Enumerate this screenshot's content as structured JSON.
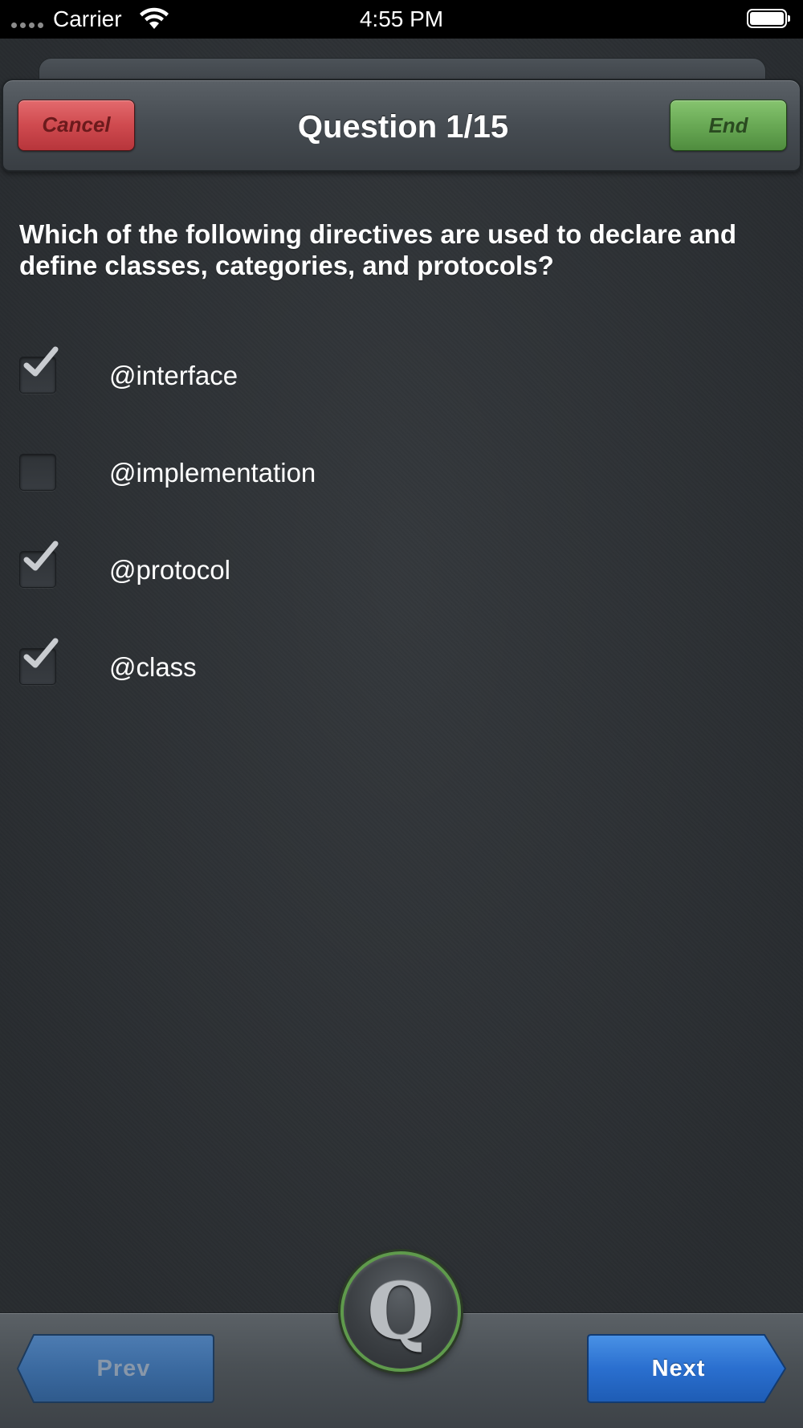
{
  "status_bar": {
    "carrier": "Carrier",
    "time": "4:55 PM",
    "icons": [
      "signal-dots-icon",
      "wifi-icon",
      "battery-icon"
    ]
  },
  "header": {
    "cancel_label": "Cancel",
    "title": "Question 1/15",
    "end_label": "End"
  },
  "question": {
    "text": "Which of the following directives are used to declare and define classes, categories, and protocols?"
  },
  "answers": [
    {
      "label": "@interface",
      "checked": true
    },
    {
      "label": "@implementation",
      "checked": false
    },
    {
      "label": "@protocol",
      "checked": true
    },
    {
      "label": "@class",
      "checked": true
    }
  ],
  "bottom_bar": {
    "prev_label": "Prev",
    "next_label": "Next",
    "center_button_letter": "Q"
  },
  "colors": {
    "cancel_red": "#cf4a4f",
    "end_green": "#69a955",
    "next_blue": "#2a6fcf",
    "prev_blue_disabled": "#3d6a9e",
    "q_ring_green": "#5f9a4c"
  }
}
